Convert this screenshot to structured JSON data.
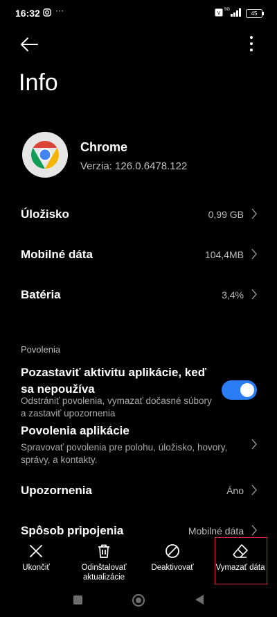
{
  "status": {
    "time": "16:32",
    "battery": "45",
    "network": "5G"
  },
  "header": {
    "title": "Info"
  },
  "app": {
    "name": "Chrome",
    "version": "Verzia: 126.0.6478.122"
  },
  "rows": [
    {
      "label": "Úložisko",
      "value": "0,99 GB"
    },
    {
      "label": "Mobilné dáta",
      "value": "104,4MB"
    },
    {
      "label": "Batéria",
      "value": "3,4%"
    }
  ],
  "permissions": {
    "section_label": "Povolenia",
    "pause_title": "Pozastaviť aktivitu aplikácie, keď sa nepoužíva",
    "pause_desc": "Odstrániť povolenia, vymazať dočasné súbory a zastaviť upozornenia",
    "pause_enabled": true,
    "app_perm_title": "Povolenia aplikácie",
    "app_perm_desc": "Spravovať povolenia pre polohu, úložisko, hovory, správy, a kontakty."
  },
  "notifications": {
    "label": "Upozornenia",
    "value": "Áno"
  },
  "connection": {
    "label": "Spôsob pripojenia",
    "value": "Mobilné dáta"
  },
  "actions": [
    {
      "label": "Ukončiť",
      "icon": "close-icon"
    },
    {
      "label": "Odinštalovať aktualizácie",
      "icon": "trash-icon"
    },
    {
      "label": "Deaktivovať",
      "icon": "disable-icon"
    },
    {
      "label": "Vymazať dáta",
      "icon": "eraser-icon"
    }
  ],
  "colors": {
    "accent": "#2b7df6",
    "highlight": "#e0242a"
  }
}
